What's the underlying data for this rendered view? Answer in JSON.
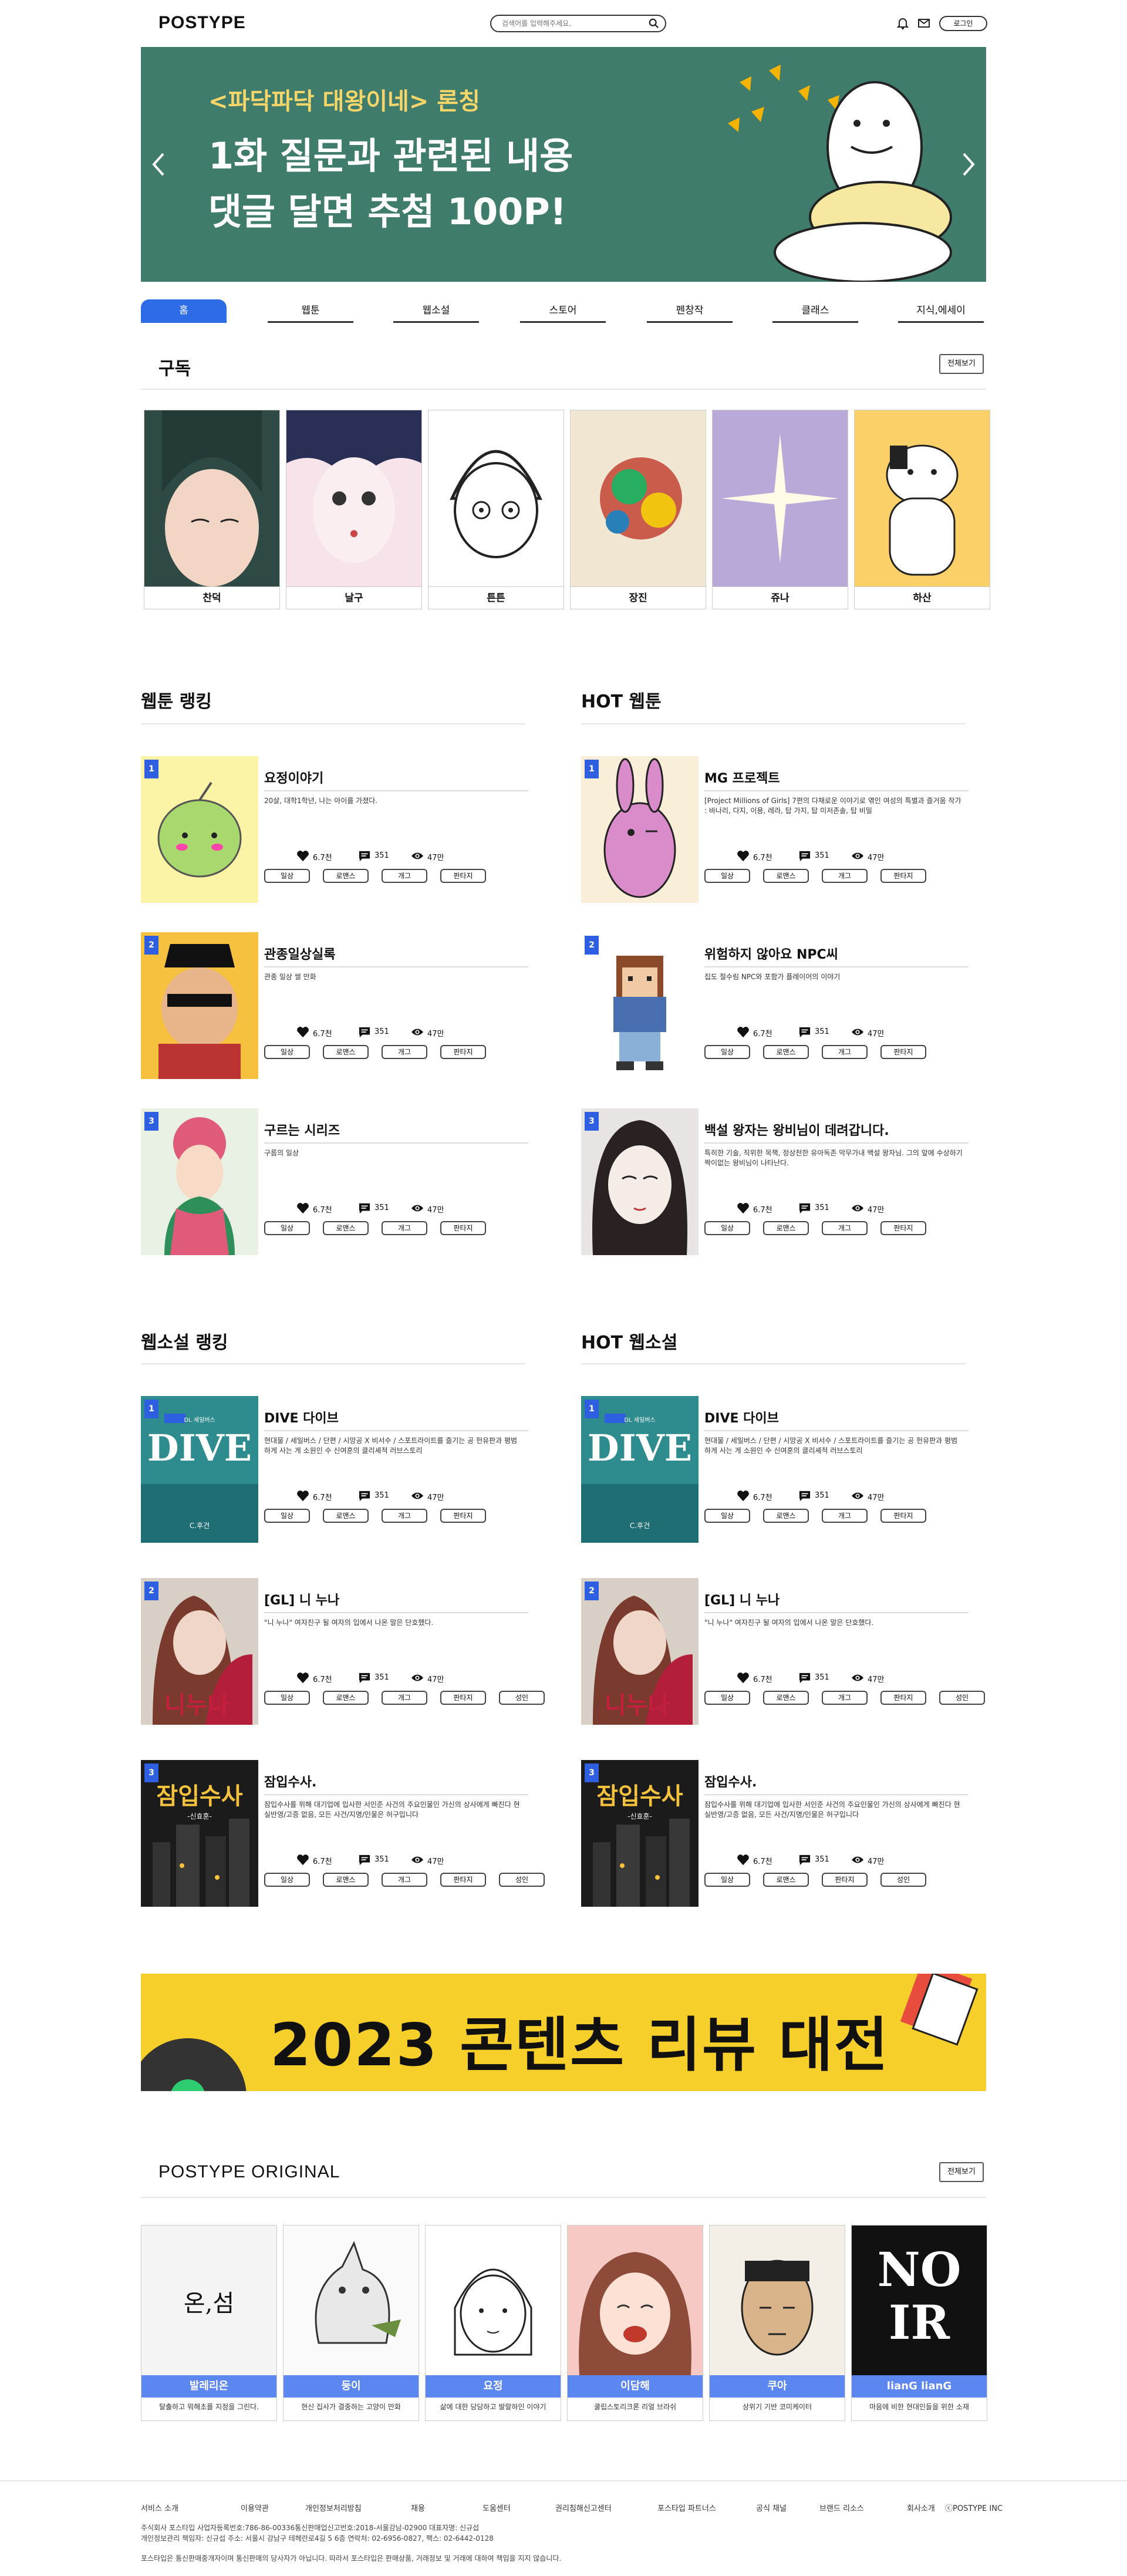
{
  "header": {
    "logo": "POSTYPE",
    "search_placeholder": "검색어를 입력해주세요.",
    "login_label": "로그인"
  },
  "banner": {
    "sub": "<파닥파닥 대왕이네> 론칭",
    "line1": "1화 질문과 관련된 내용",
    "line2": "댓글 달면 추첨 100P!"
  },
  "tabs": [
    "홈",
    "웹툰",
    "웹소설",
    "스토어",
    "펜창작",
    "클래스",
    "지식,에세이"
  ],
  "subscribe": {
    "title": "구독",
    "more": "전체보기",
    "items": [
      "찬덕",
      "날구",
      "튼튼",
      "장진",
      "쥬나",
      "하산"
    ]
  },
  "webtoon_ranking": {
    "title": "웹툰 랭킹",
    "items": [
      {
        "rank": "1",
        "title": "요정이야기",
        "desc": "20살, 대학1학년, 나는 아이를 가졌다.",
        "likes": "6.7천",
        "comments": "351",
        "views": "47만",
        "tags": [
          "일상",
          "로맨스",
          "개그",
          "판타지"
        ]
      },
      {
        "rank": "2",
        "title": "관종일상실록",
        "desc": "관종 일상 썰 만화",
        "likes": "6.7천",
        "comments": "351",
        "views": "47만",
        "tags": [
          "일상",
          "로맨스",
          "개그",
          "판타지"
        ]
      },
      {
        "rank": "3",
        "title": "구르는 시리즈",
        "desc": "구름의 일상",
        "likes": "6.7천",
        "comments": "351",
        "views": "47만",
        "tags": [
          "일상",
          "로맨스",
          "개그",
          "판타지"
        ]
      }
    ]
  },
  "hot_webtoon": {
    "title": "HOT 웹툰",
    "items": [
      {
        "rank": "1",
        "title": "MG 프로젝트",
        "desc": "[Project Millions of Girls] 7편의 다채로운 이야기로 엮인 여성의 특별과 즐거움 작가 : 바나리, 다지, 이용, 레라, 탑 가지, 탑 미저존솔, 탑 비밀",
        "likes": "6.7천",
        "comments": "351",
        "views": "47만",
        "tags": [
          "일상",
          "로맨스",
          "개그",
          "판타지"
        ]
      },
      {
        "rank": "2",
        "title": "위험하지 않아요 NPC씨",
        "desc": "집도 절수림 NPC와 포함가 플레이어의 이야기",
        "likes": "6.7천",
        "comments": "351",
        "views": "47만",
        "tags": [
          "일상",
          "로맨스",
          "개그",
          "판타지"
        ]
      },
      {
        "rank": "3",
        "title": "백설 왕자는 왕비님이 데려갑니다.",
        "desc": "특히한 기술, 직위한 목책, 정상천한 유아독존 막무가내 백설 왕자님. 그의 앞에 수상하기 짝이없는 왕비님이 나타난다.",
        "likes": "6.7천",
        "comments": "351",
        "views": "47만",
        "tags": [
          "일상",
          "로맨스",
          "개그",
          "판타지"
        ]
      }
    ]
  },
  "novel_ranking": {
    "title": "웹소설 랭킹",
    "items": [
      {
        "rank": "1",
        "title": "DIVE 다이브",
        "desc": "현대물 / 세일버스 / 단편 / 시망공 X 비서수 / 스포트라이트를 즐기는 공 헌유판과 평범하게 사는 게 소원인 수 신여훈의 클리셰적 러브스토리",
        "likes": "6.7천",
        "comments": "351",
        "views": "47만",
        "tags": [
          "일상",
          "로맨스",
          "개그",
          "판타지"
        ]
      },
      {
        "rank": "2",
        "title": "[GL] 니 누나",
        "desc": "\"니 누나\" 여자친구 될 여자의 입에서 나온 말은 단호했다.",
        "likes": "6.7천",
        "comments": "351",
        "views": "47만",
        "tags": [
          "일상",
          "로맨스",
          "개그",
          "판타지",
          "성인"
        ]
      },
      {
        "rank": "3",
        "title": "잠입수사.",
        "desc": "잠입수사를 위해 대기업에 입사한 서인준 사건의 주요인물인 가신의 상사에게 빠진다 현실반영/고증 없음, 모든 사건/지명/인물은 허구입니다",
        "likes": "6.7천",
        "comments": "351",
        "views": "47만",
        "tags": [
          "일상",
          "로맨스",
          "개그",
          "판타지",
          "성인"
        ]
      }
    ]
  },
  "hot_novel": {
    "title": "HOT 웹소설",
    "items": [
      {
        "rank": "1",
        "title": "DIVE 다이브",
        "desc": "현대물 / 세일버스 / 단편 / 시망공 X 비서수 / 스포트라이트를 즐기는 공 헌유판과 평범하게 사는 게 소원인 수 신여훈의 클리셰적 러브스토리",
        "likes": "6.7천",
        "comments": "351",
        "views": "47만",
        "tags": [
          "일상",
          "로맨스",
          "개그",
          "판타지"
        ]
      },
      {
        "rank": "2",
        "title": "[GL] 니 누나",
        "desc": "\"니 누나\" 여자친구 될 여자의 입에서 나온 말은 단호했다.",
        "likes": "6.7천",
        "comments": "351",
        "views": "47만",
        "tags": [
          "일상",
          "로맨스",
          "개그",
          "판타지",
          "성인"
        ]
      },
      {
        "rank": "3",
        "title": "잠입수사.",
        "desc": "잠입수사를 위해 대기업에 입사한 서인준 사건의 주요인물인 가신의 상사에게 빠진다 현실반영/고증 없음, 모든 사건/지명/인물은 허구입니다",
        "likes": "6.7천",
        "comments": "351",
        "views": "47만",
        "tags": [
          "일상",
          "로맨스",
          "판타지",
          "성인"
        ]
      }
    ]
  },
  "thumb_text": {
    "dive_badge": "DL 세일버스",
    "dive": "DIVE",
    "dive_author": "C.후건",
    "nuna": "니누나",
    "spy": "잠입수사",
    "spy_sub": "-신효훈-"
  },
  "review_banner": {
    "text": "2023 콘텐츠 리뷰 대전"
  },
  "original": {
    "title": "POSTYPE ORIGINAL",
    "more": "전체보기",
    "items": [
      {
        "name": "발레리온",
        "caption": "탈출하고 뭐해초를 지정을 그린다.",
        "art": "온,섬"
      },
      {
        "name": "둥이",
        "caption": "현신 집사가 결중하는 고양이 만화",
        "art": ""
      },
      {
        "name": "요정",
        "caption": "삶에 대한 담담하고 발랄하인 이야기",
        "art": ""
      },
      {
        "name": "이담해",
        "caption": "쿨립스토리크론 리얼 브라쉬",
        "art": ""
      },
      {
        "name": "쿠아",
        "caption": "상위기 기반 코미케이터",
        "art": ""
      },
      {
        "name": "lianG lianG",
        "caption": "마음에 비한 현대인들을 위한 소재",
        "art": "NO IR"
      }
    ]
  },
  "footer": {
    "links": [
      "서비스 소개",
      "이용약관",
      "개인정보처리방침",
      "채용",
      "도움센터",
      "권리침해신고센터",
      "포스타입 파트너스",
      "공식 채널",
      "브랜드 리소스",
      "회사소개",
      "ⓒPOSTYPE INC"
    ],
    "info1": "주식회사 포스타입 사업자등록번호:786-86-00336통신판매업신고번호:2018-서울강남-02900 대표자명: 신규섭",
    "info2": "개인정보관리 책임자: 신규섭 주소: 서울시 강남구 테헤란로4길 5 6층 연락처: 02-6956-0827, 팩스: 02-6442-0128",
    "info3": "포스타입은 통신판매중개자이며 통신판매의 당사자가 아닙니다. 따라서 포스타입은 판매상품, 거래정보 및 거래에 대하여 책임을 지지 않습니다."
  },
  "colors": {
    "accent": "#2e6be6",
    "banner_bg": "#3f7c6c",
    "review_bg": "#f7cf2a",
    "original_bar": "#5d87f0"
  }
}
